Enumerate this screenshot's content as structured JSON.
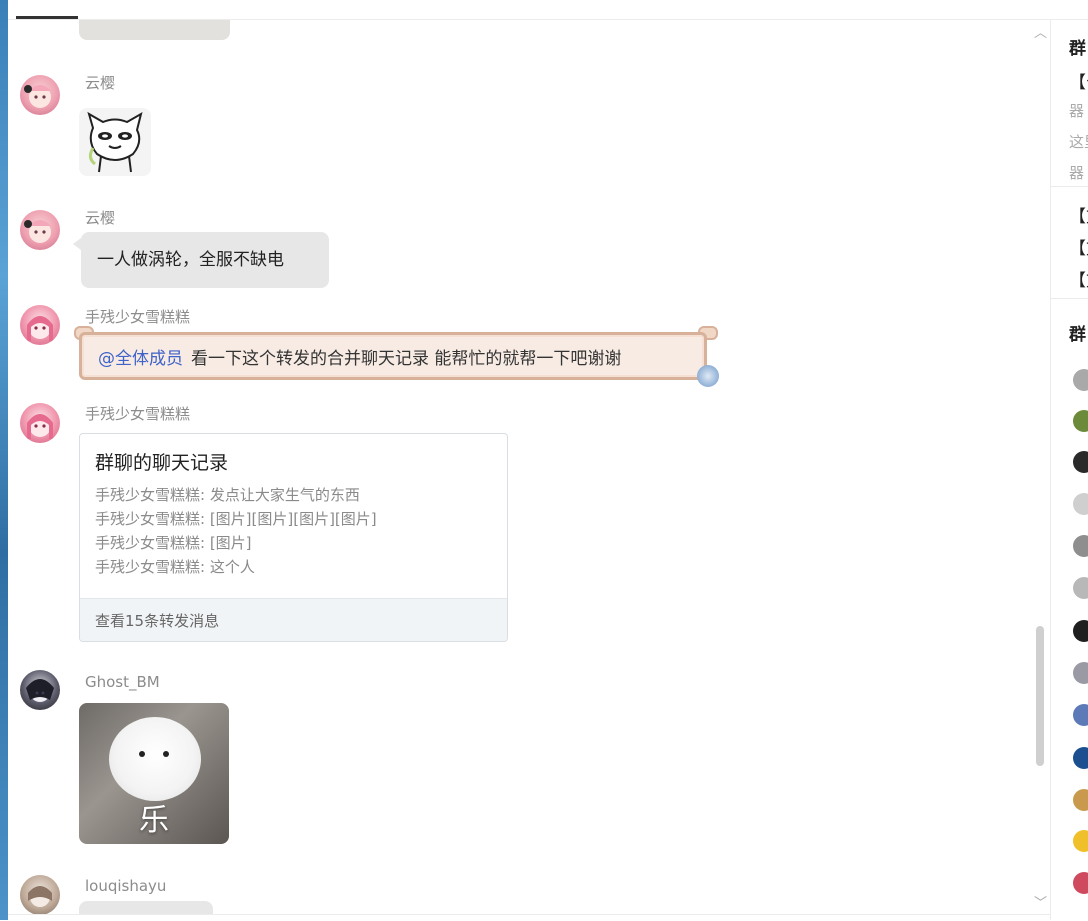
{
  "messages": [
    {
      "sender": "云樱",
      "type": "sticker",
      "sticker": "cat-face-sticker"
    },
    {
      "sender": "云樱",
      "type": "text",
      "text": "一人做涡轮，全服不缺电"
    },
    {
      "sender": "手残少女雪糕糕",
      "type": "text",
      "mention": "@全体成员",
      "text": "看一下这个转发的合并聊天记录 能帮忙的就帮一下吧谢谢"
    },
    {
      "sender": "手残少女雪糕糕",
      "type": "forward",
      "forward": {
        "title": "群聊的聊天记录",
        "lines": [
          "手残少女雪糕糕: 发点让大家生气的东西",
          "手残少女雪糕糕: [图片][图片][图片][图片]",
          "手残少女雪糕糕: [图片]",
          "手残少女雪糕糕: 这个人"
        ],
        "footer": "查看15条转发消息"
      }
    },
    {
      "sender": "Ghost_BM",
      "type": "sticker",
      "sticker": "white-dog-sticker",
      "sticker_text": "乐"
    },
    {
      "sender": "louqishayu",
      "type": "text",
      "text": ""
    }
  ],
  "side_panel": {
    "heading": "群",
    "items": [
      {
        "text": "【公",
        "style": "bold"
      },
      {
        "text": "器",
        "style": "grey"
      },
      {
        "text": "这里",
        "style": "grey"
      },
      {
        "text": "器",
        "style": "grey"
      },
      {
        "text": "【文",
        "style": "bold"
      },
      {
        "text": "【文",
        "style": "bold"
      },
      {
        "text": "【文",
        "style": "bold"
      }
    ],
    "members_heading": "群"
  },
  "icons": {
    "scroll_up": "scroll-up-icon",
    "scroll_down": "scroll-down-icon"
  },
  "colors": {
    "mention": "#3f63c8",
    "bubble": "#e7e7e7",
    "fancy_border": "#d8b19a"
  }
}
